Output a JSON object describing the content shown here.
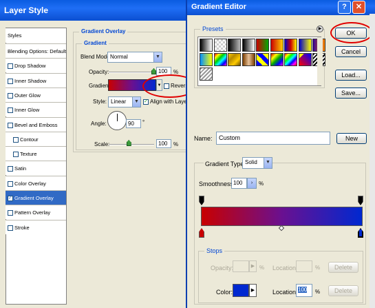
{
  "layer_style": {
    "title": "Layer Style",
    "styles_header": "Styles",
    "items": [
      {
        "label": "Blending Options: Default",
        "checkbox": false,
        "active": false
      },
      {
        "label": "Drop Shadow",
        "checkbox": true,
        "active": false
      },
      {
        "label": "Inner Shadow",
        "checkbox": true,
        "active": false
      },
      {
        "label": "Outer Glow",
        "checkbox": true,
        "active": false
      },
      {
        "label": "Inner Glow",
        "checkbox": true,
        "active": false
      },
      {
        "label": "Bevel and Emboss",
        "checkbox": true,
        "active": false
      },
      {
        "label": "Contour",
        "checkbox": true,
        "active": false
      },
      {
        "label": "Texture",
        "checkbox": true,
        "active": false
      },
      {
        "label": "Satin",
        "checkbox": true,
        "active": false
      },
      {
        "label": "Color Overlay",
        "checkbox": true,
        "active": false
      },
      {
        "label": "Gradient Overlay",
        "checkbox": true,
        "active": true
      },
      {
        "label": "Pattern Overlay",
        "checkbox": true,
        "active": false
      },
      {
        "label": "Stroke",
        "checkbox": true,
        "active": false
      }
    ],
    "group_title": "Gradient Overlay",
    "sub_group": "Gradient",
    "blend_mode_label": "Blend Mode:",
    "blend_mode_value": "Normal",
    "opacity_label": "Opacity:",
    "opacity_value": "100",
    "opacity_unit": "%",
    "gradient_label": "Gradient:",
    "reverse_label": "Reverse",
    "style_label": "Style:",
    "style_value": "Linear",
    "align_label": "Align with Layer",
    "angle_label": "Angle:",
    "angle_value": "90",
    "angle_unit": "°",
    "scale_label": "Scale:",
    "scale_value": "100",
    "scale_unit": "%",
    "opacity_level": 1.0,
    "scale_level": 0.45
  },
  "gradient_editor": {
    "title": "Gradient Editor",
    "presets_label": "Presets",
    "ok_label": "OK",
    "cancel_label": "Cancel",
    "load_label": "Load...",
    "save_label": "Save...",
    "name_label": "Name:",
    "name_value": "Custom",
    "new_label": "New",
    "gradient_type_label": "Gradient Type:",
    "gradient_type_value": "Solid",
    "smoothness_label": "Smoothness:",
    "smoothness_value": "100",
    "smoothness_unit": "%",
    "stops_label": "Stops",
    "stop_opacity_label": "Opacity:",
    "stop_opacity_unit": "%",
    "location_label": "Location:",
    "location_unit": "%",
    "delete_label": "Delete",
    "color_label": "Color:",
    "color_location_label": "Location:",
    "color_location_value": "100",
    "color_location_unit": "%",
    "delete2_label": "Delete",
    "start_color": "#c80000",
    "end_color": "#0028d0",
    "stop_color": "#0028d0"
  },
  "colors": {
    "highlight_red": "#e00000",
    "titlebar": "#0a5ce0"
  }
}
